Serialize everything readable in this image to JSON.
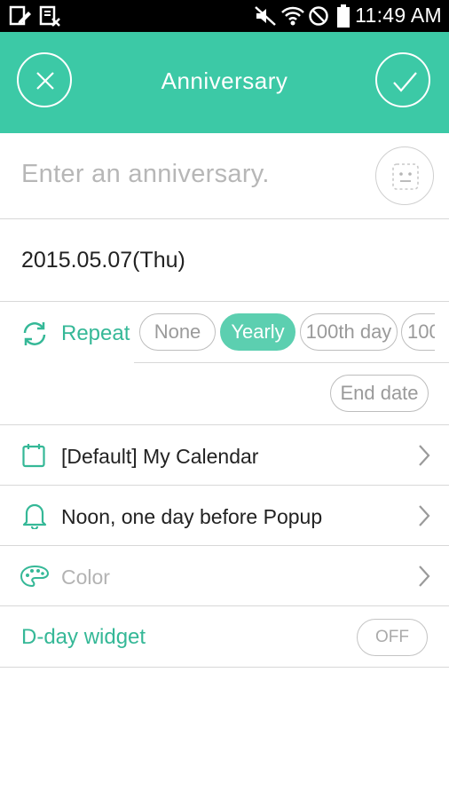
{
  "status_bar": {
    "time": "11:49 AM"
  },
  "app_bar": {
    "title": "Anniversary"
  },
  "anniversary_input": {
    "placeholder": "Enter an anniversary."
  },
  "date": {
    "value": "2015.05.07(Thu)"
  },
  "repeat": {
    "label": "Repeat",
    "options": [
      "None",
      "Yearly",
      "100th day",
      "100"
    ],
    "selected": "Yearly",
    "end_date_label": "End date"
  },
  "calendar": {
    "label": "[Default] My Calendar"
  },
  "reminder": {
    "label": "Noon, one day before Popup"
  },
  "color": {
    "label": "Color"
  },
  "dday_widget": {
    "label": "D-day widget",
    "toggle": "OFF"
  },
  "theme": {
    "accent": "#3cc9a6",
    "accent_text": "#35b897",
    "chip_selected": "#5ccfb0"
  }
}
